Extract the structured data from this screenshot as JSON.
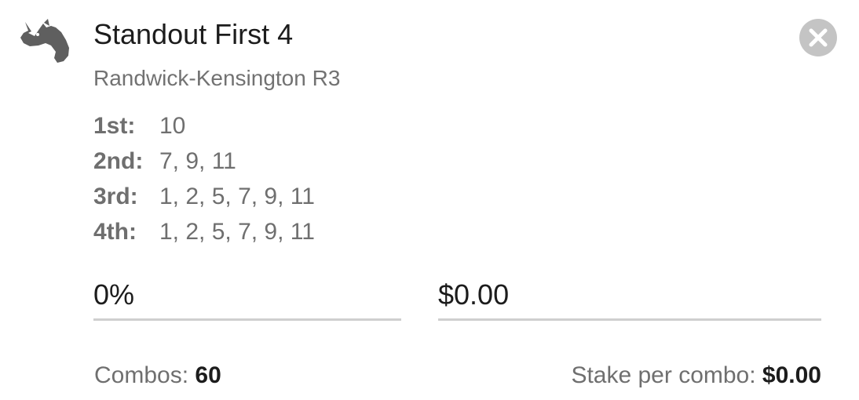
{
  "bet": {
    "icon": "horse-head-icon",
    "title": "Standout First 4",
    "race": "Randwick-Kensington R3",
    "close_icon": "close-icon"
  },
  "selections": [
    {
      "position": "1st:",
      "runners": "10"
    },
    {
      "position": "2nd:",
      "runners": "7, 9, 11"
    },
    {
      "position": "3rd:",
      "runners": "1, 2, 5, 7, 9, 11"
    },
    {
      "position": "4th:",
      "runners": "1, 2, 5, 7, 9, 11"
    }
  ],
  "inputs": {
    "percent_value": "0%",
    "stake_value": "$0.00"
  },
  "summary": {
    "combos_label": "Combos:",
    "combos_value": "60",
    "stake_per_combo_label": "Stake per combo:",
    "stake_per_combo_value": "$0.00"
  },
  "colors": {
    "icon": "#5f5f5f",
    "close_background": "#c4c4c4",
    "underline": "#cfcfcf",
    "muted_text": "#6f6f6f"
  }
}
